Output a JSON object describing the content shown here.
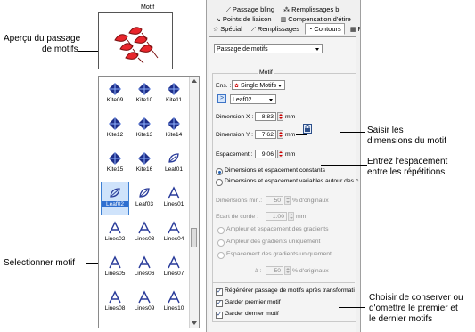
{
  "motif_panel": {
    "title": "Motif",
    "items": [
      {
        "label": "Kite09",
        "icon": "kite-icon"
      },
      {
        "label": "Kite10",
        "icon": "kite-icon"
      },
      {
        "label": "Kite11",
        "icon": "kite-icon"
      },
      {
        "label": "Kite12",
        "icon": "kite-icon"
      },
      {
        "label": "Kite13",
        "icon": "kite-icon"
      },
      {
        "label": "Kite14",
        "icon": "kite-icon"
      },
      {
        "label": "Kite15",
        "icon": "kite-icon"
      },
      {
        "label": "Kite16",
        "icon": "kite-icon"
      },
      {
        "label": "Leaf01",
        "icon": "leaf-icon"
      },
      {
        "label": "Leaf02",
        "icon": "leaf-icon",
        "selected": true
      },
      {
        "label": "Leaf03",
        "icon": "leaf-icon"
      },
      {
        "label": "Lines01",
        "icon": "lines-icon"
      },
      {
        "label": "Lines02",
        "icon": "lines-icon"
      },
      {
        "label": "Lines03",
        "icon": "lines-icon"
      },
      {
        "label": "Lines04",
        "icon": "lines-icon"
      },
      {
        "label": "Lines05",
        "icon": "lines-icon"
      },
      {
        "label": "Lines06",
        "icon": "lines-icon"
      },
      {
        "label": "Lines07",
        "icon": "lines-icon"
      },
      {
        "label": "Lines08",
        "icon": "lines-icon"
      },
      {
        "label": "Lines09",
        "icon": "lines-icon"
      },
      {
        "label": "Lines10",
        "icon": "lines-icon"
      }
    ]
  },
  "annotations": {
    "preview": [
      "Aperçu du passage",
      "de motifs"
    ],
    "select": "Selectionner motif",
    "dimensions": [
      "Saisir les",
      "dimensions du motif"
    ],
    "spacing": [
      "Entrez l'espacement",
      "entre les répétitions"
    ],
    "keep": [
      "Choisir de conserver ou",
      "d'omettre le premier et",
      "le dernier motifs"
    ]
  },
  "tabs": {
    "row1": [
      "Passage bling",
      "Remplissages bl"
    ],
    "row2": [
      "Points de liaison",
      "Compensation d'étire"
    ],
    "row3": [
      "Spécial",
      "Remplissages",
      "Contours",
      "Ré"
    ]
  },
  "props": {
    "type_dropdown": "Passage de motifs",
    "group_title": "Motif",
    "ens_label": "Ens. :",
    "ens_value": "Single Motifs",
    "motif_value": "Leaf02",
    "dim_x_label": "Dimension X :",
    "dim_x_value": "8.83",
    "dim_y_label": "Dimension Y :",
    "dim_y_value": "7.62",
    "spacing_label": "Espacement :",
    "spacing_value": "9.06",
    "unit_mm": "mm",
    "radio_const": "Dimensions et espacement constants",
    "radio_var": "Dimensions et espacement variables autour des c",
    "dim_min_label": "Dimensions min.:",
    "dim_min_value": "50",
    "dim_min_unit": "% d'originaux",
    "ecart_label": "Ecart de corde :",
    "ecart_value": "1.00",
    "radio_grad1": "Ampleur et espacement des gradients",
    "radio_grad2": "Ampleur des gradients uniquement",
    "radio_grad3": "Espacement des gradients uniquement",
    "a_label": "à :",
    "a_value": "50",
    "a_unit": "% d'originaux",
    "check_regen": "Régénérer passage de motifs après transformati",
    "check_first": "Garder premier motif",
    "check_last": "Garder dernier motif"
  }
}
